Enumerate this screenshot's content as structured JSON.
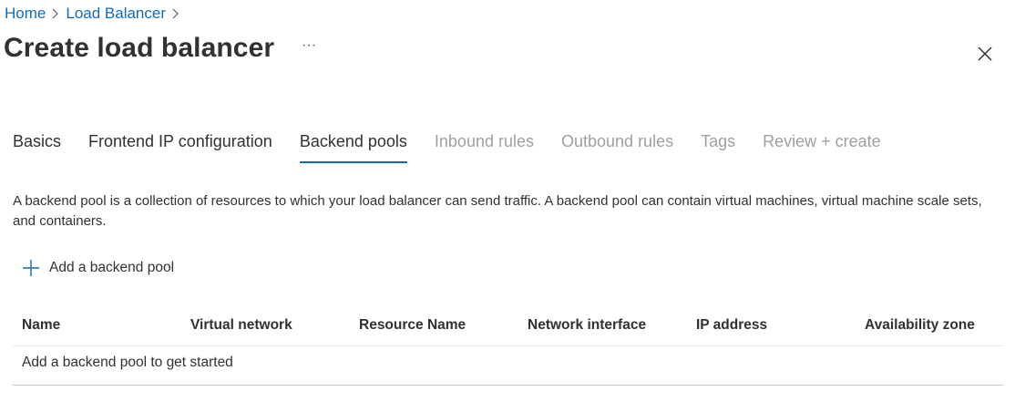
{
  "breadcrumb": {
    "items": [
      "Home",
      "Load Balancer"
    ]
  },
  "header": {
    "title": "Create load balancer",
    "more_label": "···"
  },
  "tabs": [
    {
      "label": "Basics",
      "state": "enabled"
    },
    {
      "label": "Frontend IP configuration",
      "state": "enabled"
    },
    {
      "label": "Backend pools",
      "state": "active"
    },
    {
      "label": "Inbound rules",
      "state": "disabled"
    },
    {
      "label": "Outbound rules",
      "state": "disabled"
    },
    {
      "label": "Tags",
      "state": "disabled"
    },
    {
      "label": "Review + create",
      "state": "disabled"
    }
  ],
  "main": {
    "description": "A backend pool is a collection of resources to which your load balancer can send traffic. A backend pool can contain virtual machines, virtual machine scale sets, and containers.",
    "add_label": "Add a backend pool",
    "table": {
      "columns": [
        "Name",
        "Virtual network",
        "Resource Name",
        "Network interface",
        "IP address",
        "Availability zone"
      ],
      "empty_message": "Add a backend pool to get started"
    }
  },
  "colors": {
    "accent": "#0f6cbd",
    "text": "#323130",
    "disabled": "#a19f9d"
  },
  "icons": {
    "close": "close-icon",
    "add": "plus-icon",
    "more": "more-icon",
    "breadcrumb_separator": "chevron-right-icon"
  }
}
